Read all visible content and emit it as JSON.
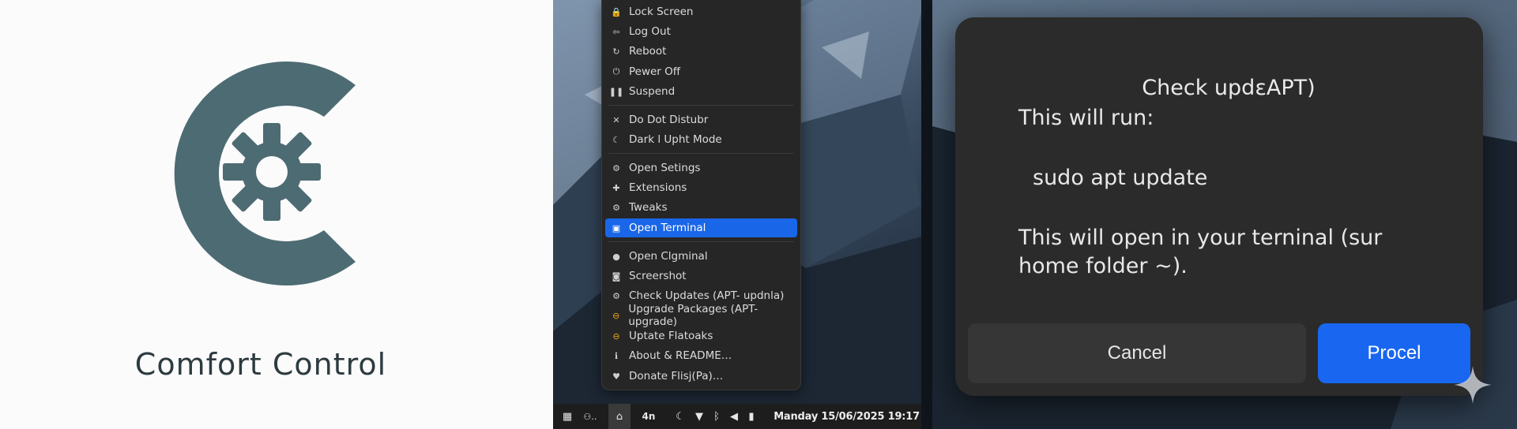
{
  "brand": {
    "title": "Comfort Control",
    "logo_color": "#4d6b73",
    "logo_icon": "gear-icon"
  },
  "menu": {
    "items": [
      {
        "label": "Lock Screen",
        "icon": "lock-icon",
        "glyph": "🔒"
      },
      {
        "label": "Log Out",
        "icon": "logout-icon",
        "glyph": "⇦"
      },
      {
        "label": "Reboot",
        "icon": "reboot-icon",
        "glyph": "↻"
      },
      {
        "label": "Pewer Off",
        "icon": "power-icon",
        "glyph": "⏻"
      },
      {
        "label": "Suspend",
        "icon": "pause-icon",
        "glyph": "❚❚"
      },
      {
        "label": "Do Dot Distubr",
        "icon": "bell-off-icon",
        "glyph": "✕"
      },
      {
        "label": "Dark l Upht Mode",
        "icon": "moon-icon",
        "glyph": "☾"
      },
      {
        "label": "Open Setings",
        "icon": "gear-icon",
        "glyph": "⚙"
      },
      {
        "label": "Extensions",
        "icon": "puzzle-icon",
        "glyph": "✚"
      },
      {
        "label": "Tweaks",
        "icon": "gear-icon",
        "glyph": "⚙"
      },
      {
        "label": "Open Terminal",
        "icon": "terminal-icon",
        "glyph": "▣",
        "active": true
      },
      {
        "label": "Open Clgminal",
        "icon": "info-icon",
        "glyph": "●"
      },
      {
        "label": "Screershot",
        "icon": "camera-icon",
        "glyph": "◙"
      },
      {
        "label": "Check Updates (APT- updnla)",
        "icon": "gear-icon",
        "glyph": "⚙"
      },
      {
        "label": "Upgrade Packages (APT-upgrade)",
        "icon": "upgrade-icon",
        "glyph": "⊖",
        "accent": "#f0a818"
      },
      {
        "label": "Uptate Flatoaks",
        "icon": "flatpak-icon",
        "glyph": "⊖",
        "accent": "#f0a818"
      },
      {
        "label": "About & README…",
        "icon": "info-icon",
        "glyph": "ℹ"
      },
      {
        "label": "Donate Flisj(Pa)…",
        "icon": "heart-icon",
        "glyph": "♥"
      }
    ]
  },
  "taskbar": {
    "clock": "Manday 15/06/2025 19:17",
    "workspace": "4n"
  },
  "dialog": {
    "title": "Check updɛAPT)",
    "line1": "This will run:",
    "command": "sudo apt update",
    "line2": "This will open in your terninal (sur",
    "line3": "home folder ~).",
    "cancel_label": "Cancel",
    "proceed_label": "Procel"
  },
  "colors": {
    "accent": "#1a66e8",
    "menu_bg": "#262626",
    "dialog_bg": "#2b2b2b"
  }
}
